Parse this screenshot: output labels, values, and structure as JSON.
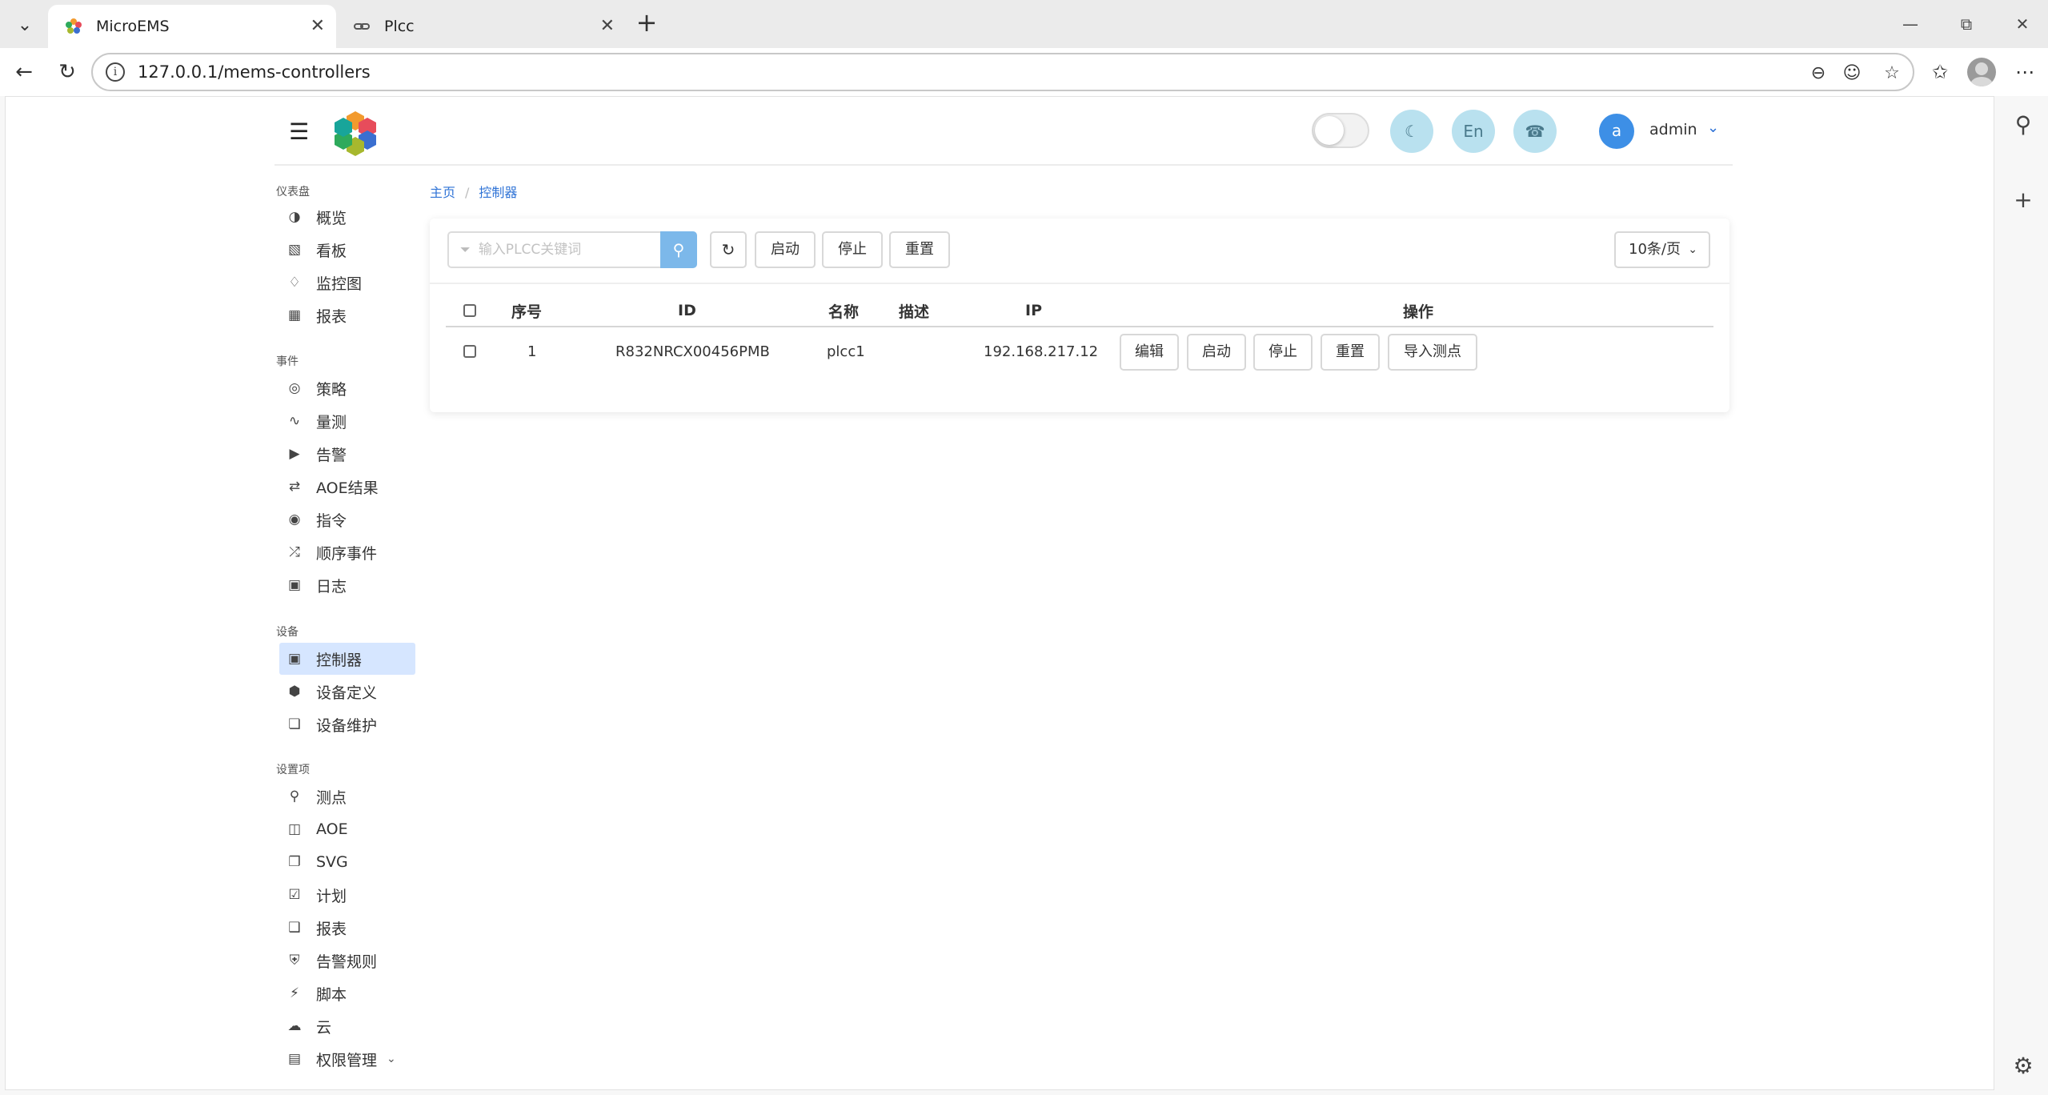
{
  "browser": {
    "tabs": [
      {
        "label": "MicroEMS",
        "active": true
      },
      {
        "label": "Plcc",
        "active": false
      }
    ],
    "url": "127.0.0.1/mems-controllers"
  },
  "header": {
    "lang_label": "En",
    "username": "admin",
    "avatar_letter": "a"
  },
  "sidebar": {
    "sections": [
      {
        "title": "仪表盘",
        "items": [
          {
            "label": "概览",
            "icon": "dashboard-icon"
          },
          {
            "label": "看板",
            "icon": "board-icon"
          },
          {
            "label": "监控图",
            "icon": "sitemap-icon"
          },
          {
            "label": "报表",
            "icon": "table-icon"
          }
        ]
      },
      {
        "title": "事件",
        "items": [
          {
            "label": "策略",
            "icon": "target-icon"
          },
          {
            "label": "量测",
            "icon": "chart-line-icon"
          },
          {
            "label": "告警",
            "icon": "megaphone-icon"
          },
          {
            "label": "AOE结果",
            "icon": "retweet-icon"
          },
          {
            "label": "指令",
            "icon": "podcast-icon"
          },
          {
            "label": "顺序事件",
            "icon": "shuffle-icon"
          },
          {
            "label": "日志",
            "icon": "book-icon"
          }
        ]
      },
      {
        "title": "设备",
        "items": [
          {
            "label": "控制器",
            "icon": "controller-icon",
            "active": true
          },
          {
            "label": "设备定义",
            "icon": "cube-icon"
          },
          {
            "label": "设备维护",
            "icon": "cubes-icon"
          }
        ]
      },
      {
        "title": "设置项",
        "items": [
          {
            "label": "测点",
            "icon": "pin-icon"
          },
          {
            "label": "AOE",
            "icon": "diagram-icon"
          },
          {
            "label": "SVG",
            "icon": "clone-icon"
          },
          {
            "label": "计划",
            "icon": "calendar-icon"
          },
          {
            "label": "报表",
            "icon": "copy-icon"
          },
          {
            "label": "告警规则",
            "icon": "shield-icon"
          },
          {
            "label": "脚本",
            "icon": "plug-icon"
          },
          {
            "label": "云",
            "icon": "cloud-icon"
          },
          {
            "label": "权限管理",
            "icon": "id-card-icon"
          }
        ]
      }
    ]
  },
  "breadcrumb": {
    "home": "主页",
    "current": "控制器"
  },
  "toolbar": {
    "search_placeholder": "输入PLCC关键词",
    "start": "启动",
    "stop": "停止",
    "reset": "重置",
    "page_size": "10条/页"
  },
  "table": {
    "columns": {
      "index": "序号",
      "id": "ID",
      "name": "名称",
      "desc": "描述",
      "ip": "IP",
      "actions": "操作"
    },
    "rows": [
      {
        "index": "1",
        "id": "R832NRCX00456PMB",
        "name": "plcc1",
        "desc": "",
        "ip": "192.168.217.12"
      }
    ],
    "row_actions": {
      "edit": "编辑",
      "start": "启动",
      "stop": "停止",
      "reset": "重置",
      "import": "导入测点"
    }
  }
}
